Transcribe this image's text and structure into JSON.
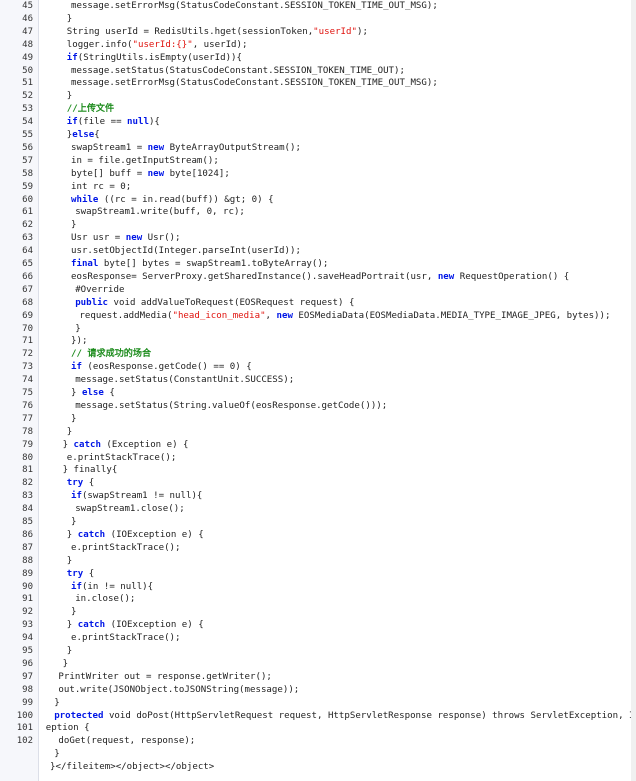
{
  "editor": {
    "lines": [
      {
        "n": "45",
        "indent": 5,
        "tokens": [
          [
            "t",
            "message.setErrorMsg(StatusCodeConstant.SESSION_TOKEN_TIME_OUT_MSG);"
          ]
        ]
      },
      {
        "n": "46",
        "indent": 4,
        "tokens": [
          [
            "t",
            "}"
          ]
        ]
      },
      {
        "n": "47",
        "indent": 4,
        "tokens": [
          [
            "t",
            "String userId = RedisUtils.hget(sessionToken,"
          ],
          [
            "s",
            "\"userId\""
          ],
          [
            "t",
            ");"
          ]
        ]
      },
      {
        "n": "48",
        "indent": 4,
        "tokens": [
          [
            "t",
            "logger.info("
          ],
          [
            "s",
            "\"userId:{}\""
          ],
          [
            "t",
            ", userId);"
          ]
        ]
      },
      {
        "n": "49",
        "indent": 4,
        "tokens": [
          [
            "k",
            "if"
          ],
          [
            "t",
            "(StringUtils.isEmpty(userId)){"
          ]
        ]
      },
      {
        "n": "50",
        "indent": 5,
        "tokens": [
          [
            "t",
            "message.setStatus(StatusCodeConstant.SESSION_TOKEN_TIME_OUT);"
          ]
        ]
      },
      {
        "n": "51",
        "indent": 5,
        "tokens": [
          [
            "t",
            "message.setErrorMsg(StatusCodeConstant.SESSION_TOKEN_TIME_OUT_MSG);"
          ]
        ]
      },
      {
        "n": "52",
        "indent": 4,
        "tokens": [
          [
            "t",
            "}"
          ]
        ]
      },
      {
        "n": "53",
        "indent": 4,
        "tokens": [
          [
            "c",
            "//上传文件"
          ]
        ]
      },
      {
        "n": "54",
        "indent": 4,
        "tokens": [
          [
            "k",
            "if"
          ],
          [
            "t",
            "(file == "
          ],
          [
            "k",
            "null"
          ],
          [
            "t",
            "){"
          ]
        ]
      },
      {
        "n": "55",
        "indent": 4,
        "tokens": [
          [
            "t",
            "}"
          ],
          [
            "k",
            "else"
          ],
          [
            "t",
            "{"
          ]
        ]
      },
      {
        "n": "56",
        "indent": 5,
        "tokens": [
          [
            "t",
            "swapStream1 = "
          ],
          [
            "k",
            "new"
          ],
          [
            "t",
            " ByteArrayOutputStream();"
          ]
        ]
      },
      {
        "n": "57",
        "indent": 5,
        "tokens": [
          [
            "t",
            "in = file.getInputStream();"
          ]
        ]
      },
      {
        "n": "58",
        "indent": 5,
        "tokens": [
          [
            "t",
            "byte[] buff = "
          ],
          [
            "k",
            "new"
          ],
          [
            "t",
            " byte[1024];"
          ]
        ]
      },
      {
        "n": "59",
        "indent": 5,
        "tokens": [
          [
            "t",
            "int rc = 0;"
          ]
        ]
      },
      {
        "n": "60",
        "indent": 5,
        "tokens": [
          [
            "k",
            "while"
          ],
          [
            "t",
            " ((rc = in.read(buff)) &gt; 0) {"
          ]
        ]
      },
      {
        "n": "61",
        "indent": 6,
        "tokens": [
          [
            "t",
            "swapStream1.write(buff, 0, rc);"
          ]
        ]
      },
      {
        "n": "62",
        "indent": 5,
        "tokens": [
          [
            "t",
            "}"
          ]
        ]
      },
      {
        "n": "63",
        "indent": 5,
        "tokens": [
          [
            "t",
            "Usr usr = "
          ],
          [
            "k",
            "new"
          ],
          [
            "t",
            " Usr();"
          ]
        ]
      },
      {
        "n": "64",
        "indent": 5,
        "tokens": [
          [
            "t",
            "usr.setObjectId(Integer.parseInt(userId));"
          ]
        ]
      },
      {
        "n": "65",
        "indent": 5,
        "tokens": [
          [
            "k",
            "final"
          ],
          [
            "t",
            " byte[] bytes = swapStream1.toByteArray();"
          ]
        ]
      },
      {
        "n": "66",
        "indent": 5,
        "tokens": [
          [
            "t",
            "eosResponse= ServerProxy.getSharedInstance().saveHeadPortrait(usr, "
          ],
          [
            "k",
            "new"
          ],
          [
            "t",
            " RequestOperation() {"
          ]
        ]
      },
      {
        "n": "67",
        "indent": 6,
        "tokens": [
          [
            "t",
            "#Override"
          ]
        ]
      },
      {
        "n": "68",
        "indent": 6,
        "tokens": [
          [
            "k",
            "public"
          ],
          [
            "t",
            " void addValueToRequest(EOSRequest request) {"
          ]
        ]
      },
      {
        "n": "69",
        "indent": 7,
        "tokens": [
          [
            "t",
            "request.addMedia("
          ],
          [
            "s",
            "\"head_icon_media\""
          ],
          [
            "t",
            ", "
          ],
          [
            "k",
            "new"
          ],
          [
            "t",
            " EOSMediaData(EOSMediaData.MEDIA_TYPE_IMAGE_JPEG, bytes));"
          ]
        ]
      },
      {
        "n": "70",
        "indent": 6,
        "tokens": [
          [
            "t",
            "}"
          ]
        ]
      },
      {
        "n": "71",
        "indent": 5,
        "tokens": [
          [
            "t",
            "});"
          ]
        ]
      },
      {
        "n": "72",
        "indent": 5,
        "tokens": [
          [
            "c",
            "// 请求成功的场合"
          ]
        ]
      },
      {
        "n": "73",
        "indent": 5,
        "tokens": [
          [
            "k",
            "if"
          ],
          [
            "t",
            " (eosResponse.getCode() == 0) {"
          ]
        ]
      },
      {
        "n": "74",
        "indent": 6,
        "tokens": [
          [
            "t",
            "message.setStatus(ConstantUnit.SUCCESS);"
          ]
        ]
      },
      {
        "n": "75",
        "indent": 5,
        "tokens": [
          [
            "t",
            "} "
          ],
          [
            "k",
            "else"
          ],
          [
            "t",
            " {"
          ]
        ]
      },
      {
        "n": "76",
        "indent": 6,
        "tokens": [
          [
            "t",
            "message.setStatus(String.valueOf(eosResponse.getCode()));"
          ]
        ]
      },
      {
        "n": "77",
        "indent": 5,
        "tokens": [
          [
            "t",
            "}"
          ]
        ]
      },
      {
        "n": "78",
        "indent": 4,
        "tokens": [
          [
            "t",
            "}"
          ]
        ]
      },
      {
        "n": "79",
        "indent": 3,
        "tokens": [
          [
            "t",
            "} "
          ],
          [
            "k",
            "catch"
          ],
          [
            "t",
            " (Exception e) {"
          ]
        ]
      },
      {
        "n": "80",
        "indent": 4,
        "tokens": [
          [
            "t",
            "e.printStackTrace();"
          ]
        ]
      },
      {
        "n": "81",
        "indent": 3,
        "tokens": [
          [
            "t",
            "} finally{"
          ]
        ]
      },
      {
        "n": "82",
        "indent": 4,
        "tokens": [
          [
            "k",
            "try"
          ],
          [
            "t",
            " {"
          ]
        ]
      },
      {
        "n": "83",
        "indent": 5,
        "tokens": [
          [
            "k",
            "if"
          ],
          [
            "t",
            "(swapStream1 != null){"
          ]
        ]
      },
      {
        "n": "84",
        "indent": 6,
        "tokens": [
          [
            "t",
            "swapStream1.close();"
          ]
        ]
      },
      {
        "n": "85",
        "indent": 5,
        "tokens": [
          [
            "t",
            "}"
          ]
        ]
      },
      {
        "n": "86",
        "indent": 4,
        "tokens": [
          [
            "t",
            "} "
          ],
          [
            "k",
            "catch"
          ],
          [
            "t",
            " (IOException e) {"
          ]
        ]
      },
      {
        "n": "87",
        "indent": 5,
        "tokens": [
          [
            "t",
            "e.printStackTrace();"
          ]
        ]
      },
      {
        "n": "88",
        "indent": 4,
        "tokens": [
          [
            "t",
            "}"
          ]
        ]
      },
      {
        "n": "89",
        "indent": 4,
        "tokens": [
          [
            "k",
            "try"
          ],
          [
            "t",
            " {"
          ]
        ]
      },
      {
        "n": "90",
        "indent": 5,
        "tokens": [
          [
            "k",
            "if"
          ],
          [
            "t",
            "(in != null){"
          ]
        ]
      },
      {
        "n": "91",
        "indent": 6,
        "tokens": [
          [
            "t",
            "in.close();"
          ]
        ]
      },
      {
        "n": "92",
        "indent": 5,
        "tokens": [
          [
            "t",
            "}"
          ]
        ]
      },
      {
        "n": "93",
        "indent": 4,
        "tokens": [
          [
            "t",
            "} "
          ],
          [
            "k",
            "catch"
          ],
          [
            "t",
            " (IOException e) {"
          ]
        ]
      },
      {
        "n": "94",
        "indent": 5,
        "tokens": [
          [
            "t",
            "e.printStackTrace();"
          ]
        ]
      },
      {
        "n": "95",
        "indent": 4,
        "tokens": [
          [
            "t",
            "}"
          ]
        ]
      },
      {
        "n": "96",
        "indent": 3,
        "tokens": [
          [
            "t",
            "}"
          ]
        ]
      },
      {
        "n": "97",
        "indent": 2,
        "tokens": [
          [
            "t",
            "PrintWriter out = response.getWriter();"
          ]
        ]
      },
      {
        "n": "98",
        "indent": 2,
        "tokens": [
          [
            "t",
            "out.write(JSONObject.toJSONString(message));"
          ]
        ]
      },
      {
        "n": "99",
        "indent": 1,
        "tokens": [
          [
            "t",
            "}"
          ]
        ]
      },
      {
        "n": "100",
        "indent": 1,
        "tokens": [
          [
            "k",
            "protected"
          ],
          [
            "t",
            " void doPost(HttpServletRequest request, HttpServletResponse response) throws ServletException, IOExc"
          ]
        ]
      },
      {
        "n": "101",
        "indent": -1,
        "tokens": [
          [
            "t",
            "eption {"
          ]
        ]
      },
      {
        "n": "102",
        "indent": 2,
        "tokens": [
          [
            "t",
            "doGet(request, response);"
          ]
        ]
      },
      {
        "n": "",
        "indent": 1,
        "tokens": [
          [
            "t",
            "}"
          ]
        ]
      },
      {
        "n": "",
        "indent": 0,
        "tokens": [
          [
            "t",
            "}</fileitem></object></object>"
          ]
        ]
      }
    ]
  }
}
